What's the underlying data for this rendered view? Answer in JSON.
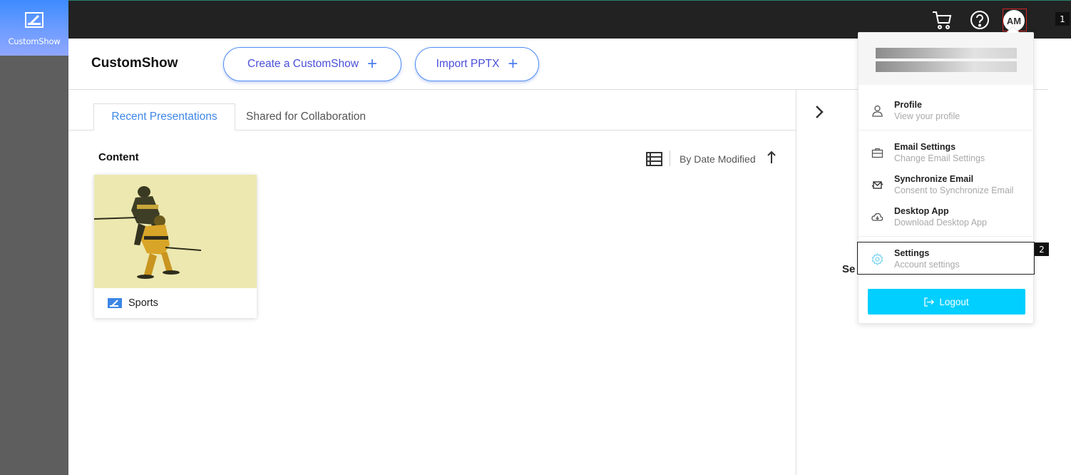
{
  "app": {
    "name": "CustomShow"
  },
  "header": {
    "title": "CustomShow",
    "create_label": "Create a CustomShow",
    "import_label": "Import PPTX"
  },
  "topbar": {
    "avatar_initials": "AM"
  },
  "tabs": [
    {
      "label": "Recent Presentations",
      "active": true
    },
    {
      "label": "Shared for Collaboration",
      "active": false
    }
  ],
  "content": {
    "section_title": "Content",
    "sort_label": "By Date Modified",
    "cards": [
      {
        "name": "Sports"
      }
    ]
  },
  "right_panel": {
    "partial_text": "Se"
  },
  "menu": {
    "items": [
      {
        "title": "Profile",
        "subtitle": "View your profile",
        "icon": "user-icon"
      },
      {
        "title": "Email Settings",
        "subtitle": "Change Email Settings",
        "icon": "briefcase-icon"
      },
      {
        "title": "Synchronize Email",
        "subtitle": "Consent to Synchronize Email",
        "icon": "sync-mail-icon"
      },
      {
        "title": "Desktop App",
        "subtitle": "Download Desktop App",
        "icon": "cloud-download-icon"
      },
      {
        "title": "Settings",
        "subtitle": "Account settings",
        "icon": "gear-icon"
      }
    ],
    "logout_label": "Logout"
  },
  "annotations": {
    "mark1": "1",
    "mark2": "2"
  },
  "colors": {
    "accent": "#3d86e6",
    "logout": "#00cfff",
    "topbar": "#222222"
  }
}
